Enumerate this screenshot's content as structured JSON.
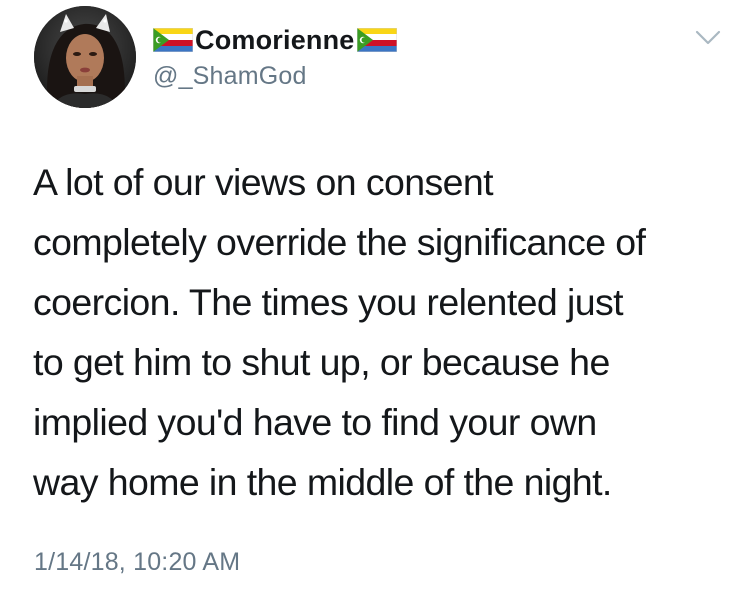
{
  "tweet": {
    "author": {
      "display_name": "Comorienne",
      "handle": "@_ShamGod",
      "avatar_icon": "profile-photo",
      "name_emoji_before": "flag-comoros-icon",
      "name_emoji_after": "flag-comoros-icon"
    },
    "menu_icon": "chevron-down-icon",
    "text_lines": [
      "A lot of our views on consent",
      "completely override the significance of",
      "coercion. The times you relented just",
      "to get him to shut up, or because he",
      "implied you'd have to find your own",
      "way home in the middle of the night."
    ],
    "timestamp": "1/14/18, 10:20 AM"
  },
  "colors": {
    "text_primary": "#14171a",
    "text_secondary": "#657786",
    "flag_green": "#3a9d23",
    "flag_blue": "#3a75c4",
    "flag_red": "#ce1126",
    "flag_yellow": "#f9d616"
  }
}
